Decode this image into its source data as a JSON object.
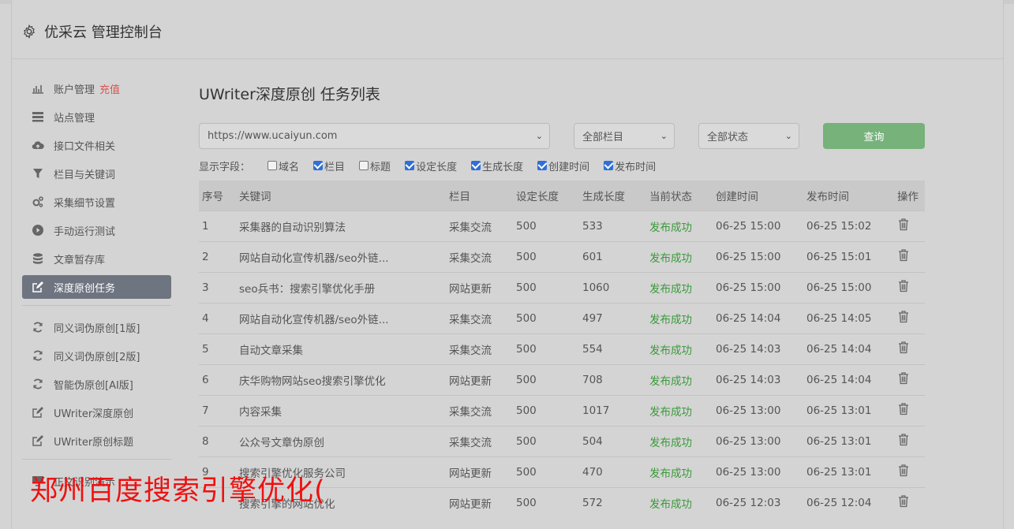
{
  "header": {
    "title": "优采云 管理控制台",
    "icon": "gear-icon"
  },
  "sidebar": {
    "group1": [
      {
        "label": "账户管理",
        "extra": "充值",
        "icon": "bar-chart-icon"
      },
      {
        "label": "站点管理",
        "icon": "server-icon"
      },
      {
        "label": "接口文件相关",
        "icon": "cloud-upload-icon"
      },
      {
        "label": "栏目与关键词",
        "icon": "filter-icon"
      },
      {
        "label": "采集细节设置",
        "icon": "cogs-icon"
      },
      {
        "label": "手动运行测试",
        "icon": "play-circle-icon"
      },
      {
        "label": "文章暂存库",
        "icon": "database-icon"
      },
      {
        "label": "深度原创任务",
        "icon": "edit-icon",
        "active": true
      }
    ],
    "group2": [
      {
        "label": "同义词伪原创[1版]",
        "icon": "refresh-icon"
      },
      {
        "label": "同义词伪原创[2版]",
        "icon": "refresh-icon"
      },
      {
        "label": "智能伪原创[AI版]",
        "icon": "refresh-icon"
      },
      {
        "label": "UWriter深度原创",
        "icon": "edit-icon"
      },
      {
        "label": "UWriter原创标题",
        "icon": "edit-icon"
      }
    ],
    "group3": [
      {
        "label": "正文识别演示",
        "icon": "monitor-icon"
      }
    ]
  },
  "main": {
    "title": "UWriter深度原创 任务列表",
    "site_select": "https://www.ucaiyun.com",
    "column_select": "全部栏目",
    "status_select": "全部状态",
    "query_label": "查询",
    "fields_label": "显示字段：",
    "fields": [
      {
        "label": "域名",
        "checked": false
      },
      {
        "label": "栏目",
        "checked": true
      },
      {
        "label": "标题",
        "checked": false
      },
      {
        "label": "设定长度",
        "checked": true
      },
      {
        "label": "生成长度",
        "checked": true
      },
      {
        "label": "创建时间",
        "checked": true
      },
      {
        "label": "发布时间",
        "checked": true
      }
    ],
    "columns": [
      "序号",
      "关键词",
      "栏目",
      "设定长度",
      "生成长度",
      "当前状态",
      "创建时间",
      "发布时间",
      "操作"
    ],
    "rows": [
      [
        "1",
        "采集器的自动识别算法",
        "采集交流",
        "500",
        "533",
        "发布成功",
        "06-25 15:00",
        "06-25 15:02"
      ],
      [
        "2",
        "网站自动化宣传机器/seo外链...",
        "采集交流",
        "500",
        "601",
        "发布成功",
        "06-25 15:00",
        "06-25 15:01"
      ],
      [
        "3",
        "seo兵书：搜索引擎优化手册",
        "网站更新",
        "500",
        "1060",
        "发布成功",
        "06-25 15:00",
        "06-25 15:00"
      ],
      [
        "4",
        "网站自动化宣传机器/seo外链...",
        "采集交流",
        "500",
        "497",
        "发布成功",
        "06-25 14:04",
        "06-25 14:05"
      ],
      [
        "5",
        "自动文章采集",
        "采集交流",
        "500",
        "554",
        "发布成功",
        "06-25 14:03",
        "06-25 14:04"
      ],
      [
        "6",
        "庆华购物网站seo搜索引擎优化",
        "网站更新",
        "500",
        "708",
        "发布成功",
        "06-25 14:03",
        "06-25 14:04"
      ],
      [
        "7",
        "内容采集",
        "采集交流",
        "500",
        "1017",
        "发布成功",
        "06-25 13:00",
        "06-25 13:01"
      ],
      [
        "8",
        "公众号文章伪原创",
        "采集交流",
        "500",
        "504",
        "发布成功",
        "06-25 13:00",
        "06-25 13:01"
      ],
      [
        "9",
        "搜索引擎优化服务公司",
        "网站更新",
        "500",
        "470",
        "发布成功",
        "06-25 13:00",
        "06-25 13:01"
      ],
      [
        "",
        "搜索引擎的网站优化",
        "网站更新",
        "500",
        "572",
        "发布成功",
        "06-25 12:03",
        "06-25 12:04"
      ]
    ],
    "delete_icon": "trash-icon"
  },
  "overlay": {
    "watermark": "郑州百度搜索引擎优化("
  }
}
